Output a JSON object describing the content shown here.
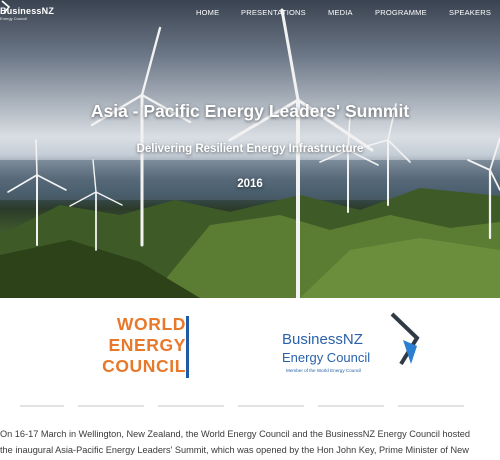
{
  "nav": {
    "logo_text": "BusinessNZ",
    "logo_sub": "Energy Council",
    "items": [
      "HOME",
      "PRESENTATIONS",
      "MEDIA",
      "PROGRAMME",
      "SPEAKERS"
    ]
  },
  "hero": {
    "title": "Asia - Pacific Energy Leaders' Summit",
    "subtitle": "Delivering Resilient Energy Infrastructure",
    "year": "2016"
  },
  "logos": {
    "wec_lines": [
      "WORLD",
      "ENERGY",
      "COUNCIL"
    ],
    "bnz_name": "BusinessNZ",
    "bnz_council": "Energy Council",
    "bnz_member": "Member of the World Energy Council"
  },
  "intro": {
    "line1": "On 16-17 March in Wellington, New Zealand, the World Energy Council and the BusinessNZ Energy Council hosted",
    "line2": "the inaugural Asia-Pacific Energy Leaders' Summit, which was opened by the Hon John Key, Prime Minister of New"
  },
  "colors": {
    "wec_orange": "#e8792a",
    "bnz_blue": "#2a62aa",
    "accent_blue": "#1f5aa6"
  }
}
